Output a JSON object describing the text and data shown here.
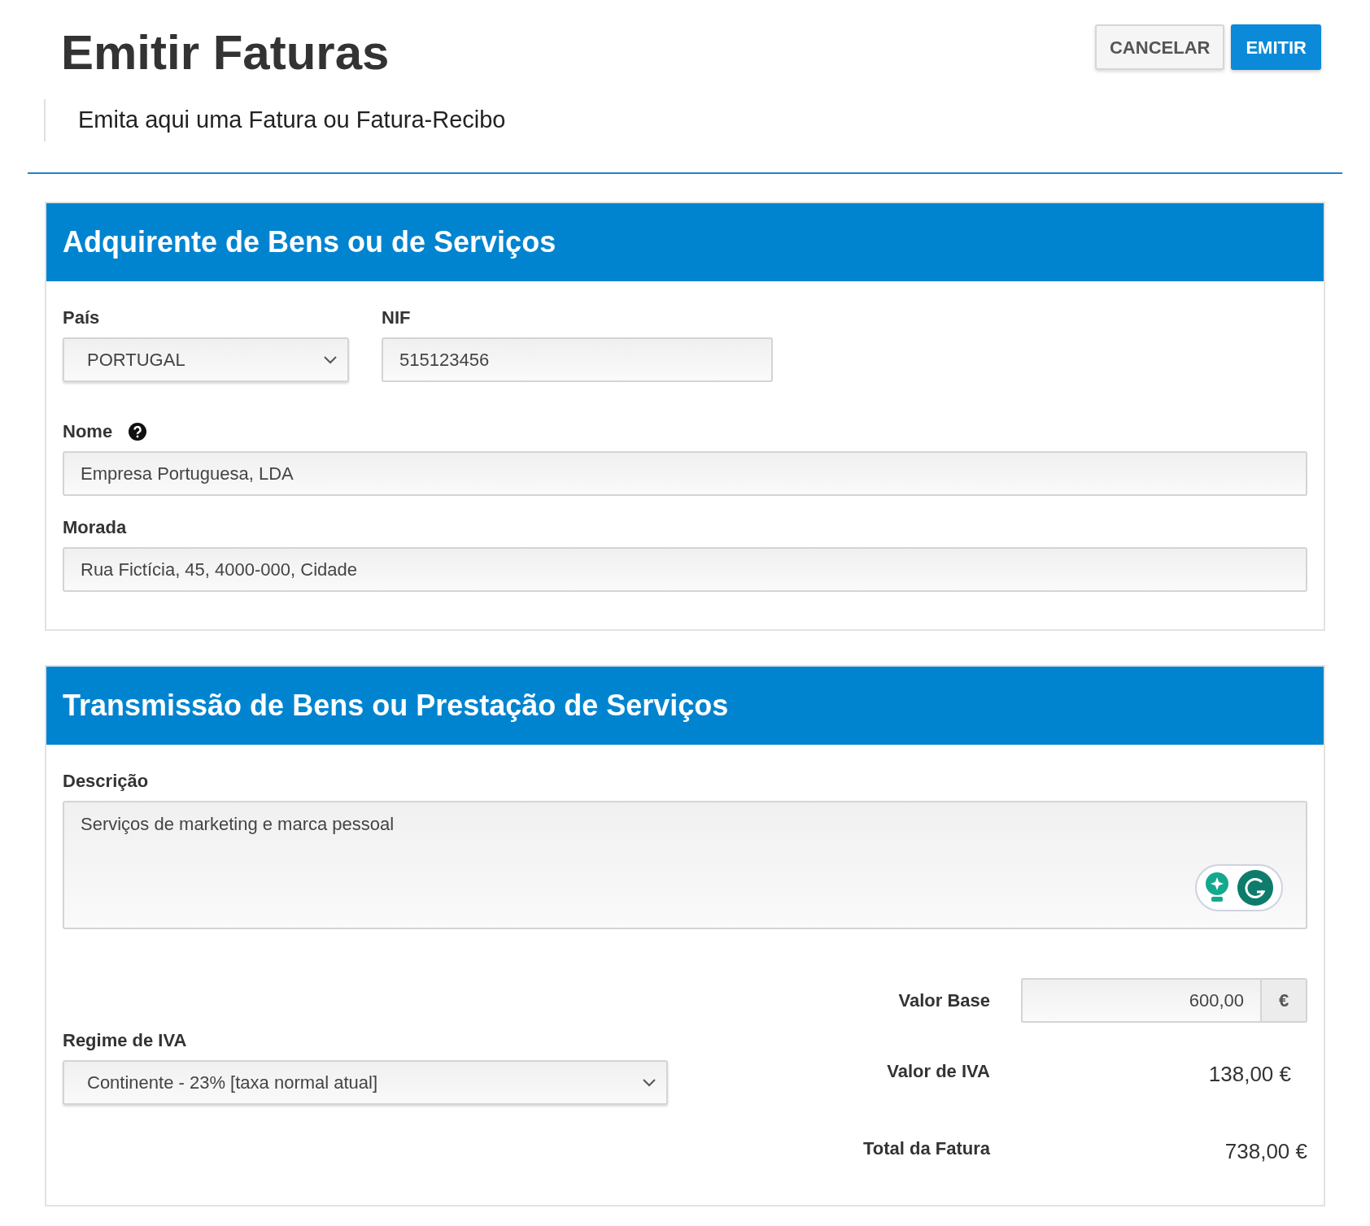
{
  "page": {
    "title": "Emitir Faturas",
    "subtitle": "Emita aqui uma Fatura ou Fatura-Recibo"
  },
  "buttons": [
    {
      "label": "CANCELAR",
      "kind": "secondary"
    },
    {
      "label": "EMITIR",
      "kind": "primary"
    }
  ],
  "buyer": {
    "title": "Adquirente de Bens ou de Serviços",
    "country": {
      "label": "País",
      "value": "PORTUGAL"
    },
    "nif": {
      "label": "NIF",
      "value": "515123456"
    },
    "name": {
      "label": "Nome",
      "value": "Empresa Portuguesa, LDA"
    },
    "address": {
      "label": "Morada",
      "value": "Rua Fictícia, 45, 4000-000, Cidade"
    }
  },
  "service": {
    "title": "Transmissão de Bens ou Prestação de Serviços",
    "description": {
      "label": "Descrição",
      "value": "Serviços de marketing e marca pessoal"
    },
    "base": {
      "label": "Valor Base",
      "value": "600,00",
      "unit": "€"
    },
    "vat_regime": {
      "label": "Regime de IVA",
      "value": "Continente - 23% [taxa normal atual]"
    },
    "vat": {
      "label": "Valor de IVA",
      "value": "138,00 €"
    },
    "total": {
      "label": "Total da Fatura",
      "value": "738,00 €"
    }
  }
}
